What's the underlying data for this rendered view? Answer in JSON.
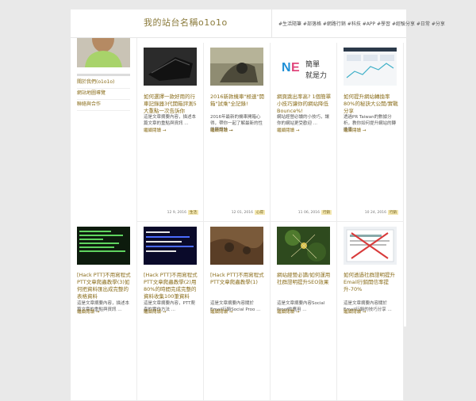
{
  "site": {
    "title": "我的站台名稱o1o1o",
    "tagline": "#生活隨筆 #部落格 #網路行銷 #科技 #APP #學習 #經驗分享 #日常 #分享"
  },
  "sidebar": {
    "items": [
      {
        "label": "關於我們(o1o1o)"
      },
      {
        "label": "網站地圖導覽"
      },
      {
        "label": "聯絡與合作"
      }
    ]
  },
  "posts": [
    {
      "title": "如何選擇一款好用的行車記錄器3代開箱評測5大重點一次告訴你",
      "excerpt": "這是文章摘要內容，描述本篇文章的重點與資訊 ...",
      "more": "繼續閱讀 →",
      "date": "12 9, 2016",
      "cat": "生活"
    },
    {
      "title": "2016新款機車\"極速\"開箱\"試乘\"全記錄!",
      "excerpt": "2016年最新的機車開箱心得，帶你一起了解最新的性能與設計 ...",
      "more": "繼續閱讀 →",
      "date": "12 01, 2016",
      "cat": "心得"
    },
    {
      "title": "網頁跳出率高? 1個簡單小技巧讓你的網站降低Bounce%!",
      "excerpt": "網站經營必讀的小技巧，讓你的網站更受歡迎 ...",
      "more": "繼續閱讀 →",
      "date": "11 06, 2016",
      "cat": "行銷"
    },
    {
      "title": "如何提升網站轉換率80%的秘訣大公開/實戰分享",
      "excerpt": "透過PR Taiwan的數據分析，教你如何提升網站的轉換率 ...",
      "more": "繼續閱讀 →",
      "date": "10 24, 2016",
      "cat": "行銷"
    },
    {
      "title": "[Hack PTT]不用寫程式PTT文章爬蟲教學(3)如何把資料匯出成完整的表格資料",
      "excerpt": "這是文章摘要內容，描述本篇文章的重點與資訊 ...",
      "more": "繼續閱讀 →",
      "date": "",
      "cat": ""
    },
    {
      "title": "[Hack PTT]不用寫程式PTT文章爬蟲教學(2)用80%的時間完成完整的資料收集100筆資料",
      "excerpt": "這是文章摘要內容，PTT爬蟲的實作方法 ...",
      "more": "繼續閱讀 →",
      "date": "",
      "cat": ""
    },
    {
      "title": "[Hack PTT]不用寫程式PTT文章爬蟲教學(1)",
      "excerpt": "這是文章摘要內容關於Email行銷Social Proo ...",
      "more": "繼續閱讀 →",
      "date": "",
      "cat": ""
    },
    {
      "title": "網站經營必讀/如何運用社群證明提升SEO效果",
      "excerpt": "這是文章摘要內容Social Proof的應用 ...",
      "more": "繼續閱讀 →",
      "date": "",
      "cat": ""
    },
    {
      "title": "如何透過社群證明提升Email行銷開信率提升-70%",
      "excerpt": "這是文章摘要內容關於Email行銷的技巧分享 ...",
      "more": "繼續閱讀 →",
      "date": "",
      "cat": ""
    }
  ]
}
